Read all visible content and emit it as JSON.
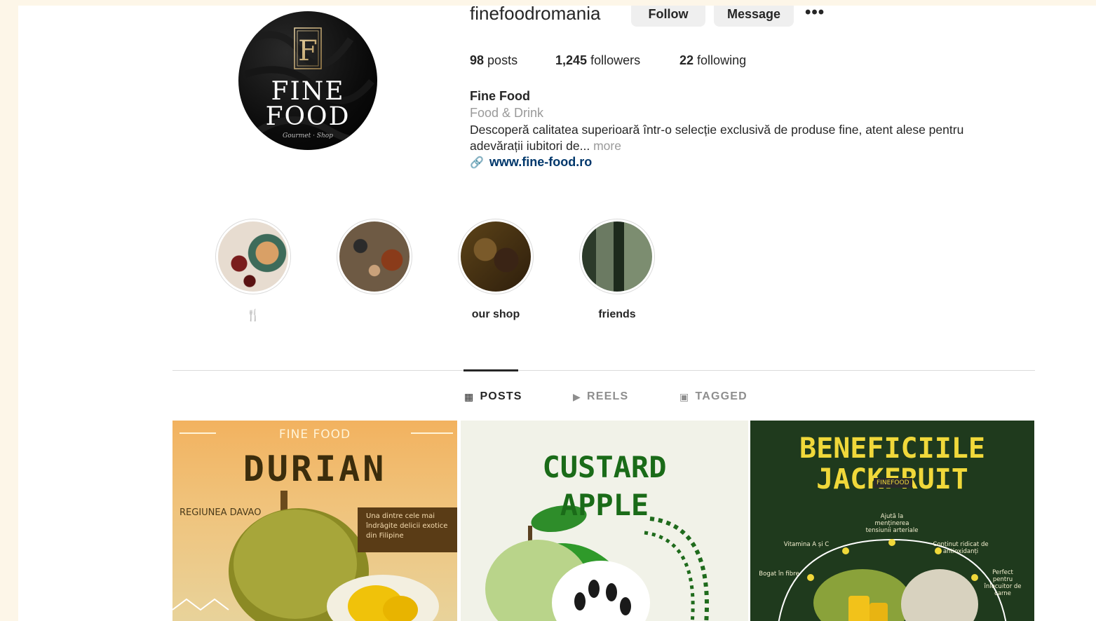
{
  "profile": {
    "username": "finefoodromania",
    "follow_label": "Follow",
    "message_label": "Message",
    "more_label": "•••",
    "avatar_text": {
      "letter": "F",
      "line1": "FINE",
      "line2": "FOOD",
      "tagline": "Gourmet · Shop"
    }
  },
  "stats": {
    "posts_count": "98",
    "posts_label": "posts",
    "followers_count": "1,245",
    "followers_label": "followers",
    "following_count": "22",
    "following_label": "following"
  },
  "bio": {
    "name": "Fine Food",
    "category": "Food & Drink",
    "text": "Descoperă calitatea superioară într-o selecție exclusivă de produse fine, atent alese pentru adevărații iubitori de...",
    "more_label": "more",
    "link_icon": "link-icon",
    "link": "www.fine-food.ro"
  },
  "highlights": [
    {
      "label": "🍴"
    },
    {
      "label": ""
    },
    {
      "label": "our shop"
    },
    {
      "label": "friends"
    }
  ],
  "tabs": {
    "posts": "POSTS",
    "reels": "REELS",
    "tagged": "TAGGED",
    "active": "posts"
  },
  "posts": [
    {
      "brand": "FINE FOOD",
      "title": "DURIAN",
      "region": "REGIUNEA DAVAO",
      "box_text": "Una dintre cele mai îndrăgite delicii exotice din Filipine"
    },
    {
      "title_line1": "CUSTARD",
      "title_line2": "APPLE"
    },
    {
      "title_line1": "BENEFICIILE",
      "title_line2": "JACKFRUIT",
      "badge": "FINEFOOD",
      "labels": [
        "Ajută la menținerea tensiunii arteriale",
        "Vitamina A și C",
        "Conținut ridicat de antioxidanți",
        "Bogat în fibre",
        "Perfect pentru înlocuitor de carne"
      ]
    }
  ],
  "colors": {
    "background": "#fdf6e8",
    "link": "#00376b",
    "button_bg": "#efefef"
  }
}
